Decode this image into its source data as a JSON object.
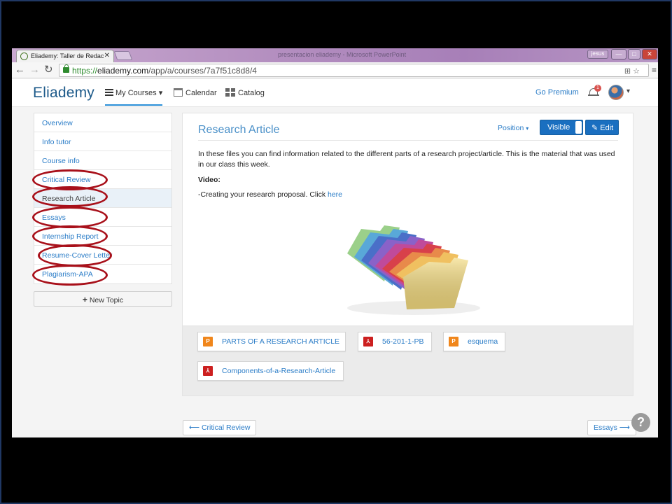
{
  "browser": {
    "tab_title": "Eliademy: Taller de Redac",
    "tab_close": "✕",
    "window_title": "presentacion eliademy - Microsoft PowerPoint",
    "user_badge": "jesus",
    "controls": {
      "minimize": "—",
      "maximize": "□",
      "close": "✕"
    },
    "nav": {
      "back": "←",
      "forward": "→",
      "reload": "↻"
    },
    "url": {
      "scheme": "https://",
      "host": "eliademy.com",
      "path": "/app/a/courses/7a7f51c8d8/4"
    },
    "url_icons": "⊞ ☆",
    "menu": "≡"
  },
  "app": {
    "logo": "Eliademy",
    "nav": {
      "my_courses": "My Courses",
      "calendar": "Calendar",
      "catalog": "Catalog",
      "go_premium": "Go Premium",
      "notification_count": "1",
      "chevron": "▾"
    }
  },
  "sidebar": {
    "items": [
      {
        "label": "Overview"
      },
      {
        "label": "Info tutor"
      },
      {
        "label": "Course info"
      },
      {
        "label": "Critical Review"
      },
      {
        "label": "Research Article"
      },
      {
        "label": "Essays"
      },
      {
        "label": "Internship Report"
      },
      {
        "label": "Resume-Cover Letter"
      },
      {
        "label": "Plagiarism-APA"
      }
    ],
    "new_topic": "New Topic",
    "new_topic_icon": "+"
  },
  "topic": {
    "title": "Research Article",
    "position_label": "Position",
    "visible_label": "Visible",
    "edit_label": "Edit",
    "edit_icon": "✎",
    "paragraph": "In these files you can find information related to the different parts of a research project/article. This is the material that was used in our class this week.",
    "video_heading": "Video:",
    "video_text": "-Creating your research proposal. Click ",
    "video_link": "here"
  },
  "files": [
    {
      "name": "PARTS OF A RESEARCH ARTICLE",
      "type": "ppt",
      "icon_glyph": "P"
    },
    {
      "name": "56-201-1-PB",
      "type": "pdf",
      "icon_glyph": "⅄"
    },
    {
      "name": "esquema",
      "type": "ppt",
      "icon_glyph": "P"
    },
    {
      "name": "Components-of-a-Research-Article",
      "type": "pdf",
      "icon_glyph": "⅄"
    }
  ],
  "pager": {
    "prev_label": "⟵ Critical Review",
    "next_label": "Essays ⟶"
  },
  "help_label": "?",
  "colors": {
    "accent": "#2a7cc7",
    "primary_button": "#1a6fc0",
    "annotation_circle": "#a8101a",
    "ppt_icon": "#f0861b",
    "pdf_icon": "#cc1f1f"
  }
}
